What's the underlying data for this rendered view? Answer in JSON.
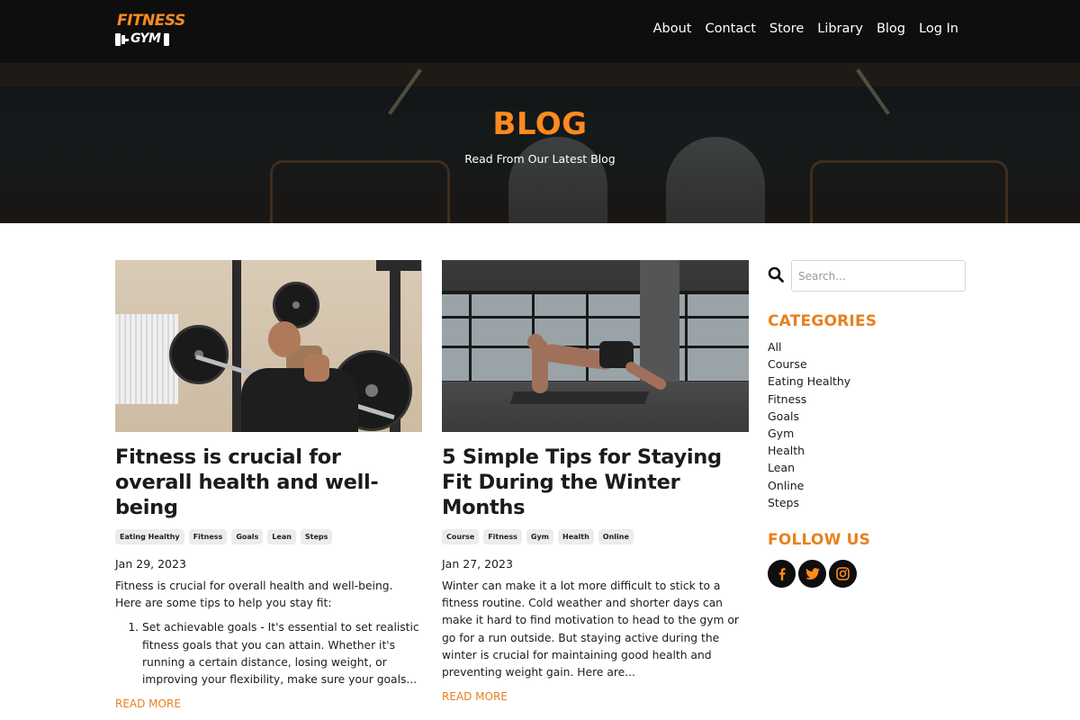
{
  "nav": {
    "logo_top": "FITNESS",
    "logo_bottom": "GYM",
    "links": [
      "About",
      "Contact",
      "Store",
      "Library",
      "Blog",
      "Log In"
    ]
  },
  "hero": {
    "title": "BLOG",
    "subtitle": "Read From Our Latest Blog"
  },
  "posts": [
    {
      "title": "Fitness is crucial for overall health and well-being",
      "tags": [
        "Eating Healthy",
        "Fitness",
        "Goals",
        "Lean",
        "Steps"
      ],
      "date": "Jan 29, 2023",
      "excerpt": "Fitness is crucial for overall health and well-being. Here are some tips to help you stay fit:",
      "list": [
        "Set achievable goals - It's essential to set realistic fitness goals that you can attain. Whether it's running a certain distance, losing weight, or improving your flexibility, make sure your goals..."
      ],
      "read_more": "READ MORE"
    },
    {
      "title": "5 Simple Tips for Staying Fit During the Winter Months",
      "tags": [
        "Course",
        "Fitness",
        "Gym",
        "Health",
        "Online"
      ],
      "date": "Jan 27, 2023",
      "excerpt": "Winter can make it a lot more difficult to stick to a fitness routine. Cold weather and shorter days can make it hard to find motivation to head to the gym or go for a run outside. But staying active during the winter is crucial for maintaining good health and preventing weight gain. Here are...",
      "read_more": "READ MORE"
    }
  ],
  "sidebar": {
    "search_placeholder": "Search...",
    "categories_heading": "CATEGORIES",
    "categories": [
      "All",
      "Course",
      "Eating Healthy",
      "Fitness",
      "Goals",
      "Gym",
      "Health",
      "Lean",
      "Online",
      "Steps"
    ],
    "follow_heading": "FOLLOW US",
    "social": [
      "facebook-icon",
      "twitter-icon",
      "instagram-icon"
    ]
  },
  "colors": {
    "accent": "#e8801e",
    "hero_title": "#ff8a1e",
    "nav_bg": "#0e0e0e"
  }
}
